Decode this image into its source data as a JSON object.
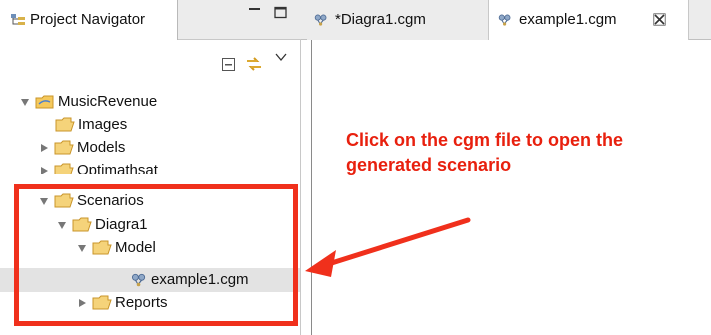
{
  "navigator": {
    "tab_label": "Project Navigator",
    "tree": [
      {
        "label": "MusicRevenue",
        "expanded": true,
        "kind": "project"
      },
      {
        "label": "Images",
        "kind": "folder"
      },
      {
        "label": "Models",
        "kind": "folder",
        "expanded": false
      },
      {
        "label": "Optimathsat",
        "kind": "folder",
        "expanded": false
      },
      {
        "label": "Scenarios",
        "kind": "folder",
        "expanded": true
      },
      {
        "label": "Diagra1",
        "kind": "folder",
        "expanded": true
      },
      {
        "label": "Model",
        "kind": "folder",
        "expanded": true
      },
      {
        "label": "example1.cgm",
        "kind": "file",
        "selected": true
      },
      {
        "label": "Reports",
        "kind": "folder",
        "expanded": false
      }
    ]
  },
  "editor": {
    "tabs": [
      {
        "label": "*Diagra1.cgm",
        "active": false
      },
      {
        "label": "example1.cgm",
        "active": true
      }
    ]
  },
  "annotation": {
    "line1": "Click on the cgm file to open the",
    "line2": "generated scenario",
    "color": "#e8200e"
  },
  "icons": {
    "tab": "project-navigator-icon",
    "folder": "folder-icon",
    "file": "cgm-file-icon"
  }
}
